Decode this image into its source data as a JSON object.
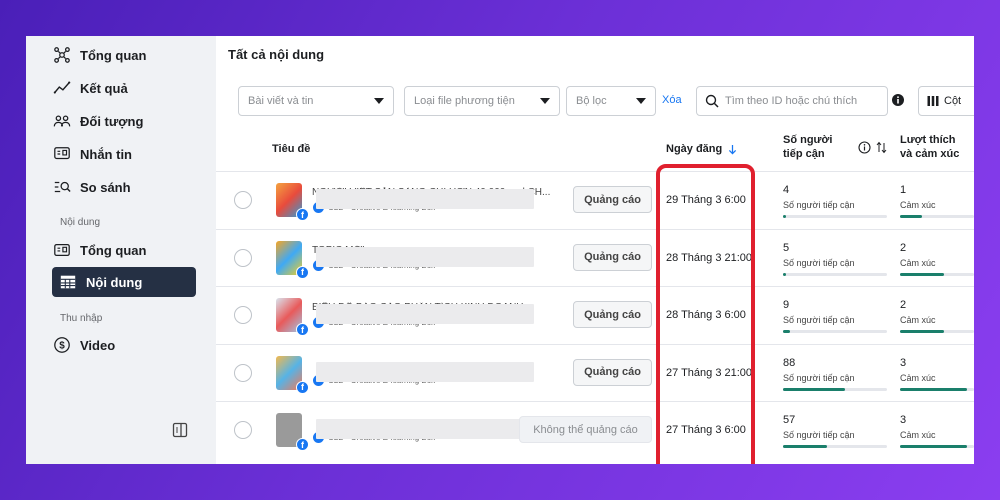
{
  "sidebar": {
    "items": [
      {
        "label": "Tổng quan",
        "icon": "network-icon"
      },
      {
        "label": "Kết quả",
        "icon": "trend-line-icon"
      },
      {
        "label": "Đối tượng",
        "icon": "people-icon"
      },
      {
        "label": "Nhắn tin",
        "icon": "message-icon"
      },
      {
        "label": "So sánh",
        "icon": "compare-icon"
      }
    ],
    "section_content": "Nội dung",
    "content_items": [
      {
        "label": "Tổng quan",
        "icon": "grid-icon"
      },
      {
        "label": "Nội dung",
        "icon": "table-icon",
        "active": true
      }
    ],
    "section_income": "Thu nhập",
    "income_items": [
      {
        "label": "Video",
        "icon": "dollar-circle-icon"
      }
    ]
  },
  "main": {
    "title": "Tất cả nội dung",
    "filters": {
      "post_type": "Bài viết và tin",
      "file_type": "Loại file phương tiện",
      "filter": "Bộ lọc",
      "clear": "Xóa",
      "search_placeholder": "Tìm theo ID hoặc chú thích",
      "columns": "Cột"
    },
    "headers": {
      "title": "Tiêu đề",
      "date": "Ngày đăng",
      "reach_line1": "Số người",
      "reach_line2": "tiếp cận",
      "reactions_line1": "Lượt thích",
      "reactions_line2": "và cảm xúc"
    },
    "rows": [
      {
        "title": "NGƯỜI VIỆT SẴN SÀNG CHI HƠN 40.000 ... d CH...",
        "page": "CLB - Creative E-learning Box",
        "action": "Quảng cáo",
        "date": "29 Tháng 3 6:00",
        "reach": "4",
        "reach_label": "Số người tiếp cận",
        "reach_frac": 0.03,
        "reactions": "1",
        "reactions_label": "Cảm xúc",
        "reactions_frac": 0.3
      },
      {
        "title": "TOPIC MỚI ... mục ...",
        "page": "CLB - Creative E-learning Box",
        "action": "Quảng cáo",
        "date": "28 Tháng 3 21:00",
        "reach": "5",
        "reach_label": "Số người tiếp cận",
        "reach_frac": 0.03,
        "reactions": "2",
        "reactions_label": "Cảm xúc",
        "reactions_frac": 0.6
      },
      {
        "title": "BIỂU ĐỒ BÁO CÁO PHÂN TÍCH KINH DOANH ...",
        "page": "CLB - Creative E-learning Box",
        "action": "Quảng cáo",
        "date": "28 Tháng 3 6:00",
        "reach": "9",
        "reach_label": "Số người tiếp cận",
        "reach_frac": 0.07,
        "reactions": "2",
        "reactions_label": "Cảm xúc",
        "reactions_frac": 0.6
      },
      {
        "title": "",
        "page": "CLB - Creative E-learning Box",
        "action": "Quảng cáo",
        "date": "27 Tháng 3 21:00",
        "reach": "88",
        "reach_label": "Số người tiếp cận",
        "reach_frac": 0.6,
        "reactions": "3",
        "reactions_label": "Cảm xúc",
        "reactions_frac": 0.9
      },
      {
        "title": "",
        "page": "CLB - Creative E-learning Box",
        "action": "Không thể quảng cáo",
        "date": "27 Tháng 3 6:00",
        "reach": "57",
        "reach_label": "Số người tiếp cận",
        "reach_frac": 0.42,
        "reactions": "3",
        "reactions_label": "Cảm xúc",
        "reactions_frac": 0.9
      }
    ],
    "accent_color": "#1877f2",
    "highlight_color": "#e0202e"
  }
}
